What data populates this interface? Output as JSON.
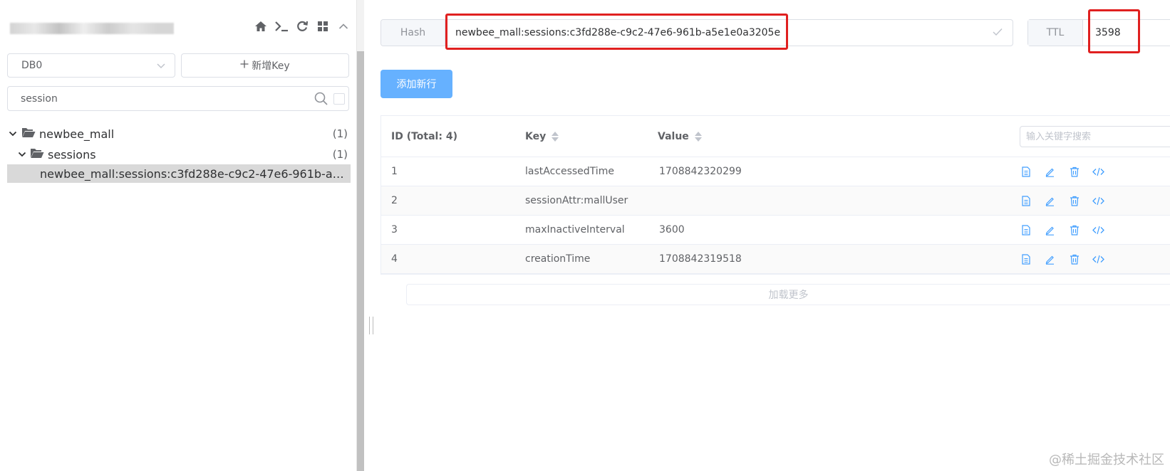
{
  "connection": {
    "name": "",
    "icons": [
      "home-icon",
      "terminal-icon",
      "refresh-icon",
      "grid-icon",
      "collapse-up-icon"
    ]
  },
  "db_select": {
    "value": "DB0"
  },
  "new_key_button": {
    "label": "新增Key"
  },
  "filter": {
    "value": "session"
  },
  "tree": {
    "folder1": {
      "label": "newbee_mall",
      "count": "(1)"
    },
    "folder2": {
      "label": "sessions",
      "count": "(1)"
    },
    "key_item": {
      "label": "newbee_mall:sessions:c3fd288e-c9c2-47e6-961b-a5e1..."
    }
  },
  "key_header": {
    "type_label": "Hash",
    "key_value": "newbee_mall:sessions:c3fd288e-c9c2-47e6-961b-a5e1e0a3205e",
    "ttl_label": "TTL",
    "ttl_value": "3598"
  },
  "add_row_button": {
    "label": "添加新行"
  },
  "table": {
    "headers": {
      "id": "ID (Total: 4)",
      "key": "Key",
      "value": "Value"
    },
    "search_placeholder": "输入关键字搜索",
    "rows": [
      {
        "id": "1",
        "key": "lastAccessedTime",
        "value": "1708842320299"
      },
      {
        "id": "2",
        "key": "sessionAttr:mallUser",
        "value": ""
      },
      {
        "id": "3",
        "key": "maxInactiveInterval",
        "value": "3600"
      },
      {
        "id": "4",
        "key": "creationTime",
        "value": "1708842319518"
      }
    ]
  },
  "load_more": {
    "label": "加载更多"
  },
  "watermark": {
    "text": "@稀土掘金技术社区"
  },
  "colors": {
    "primary": "#66b1ff",
    "icon_blue": "#409eff",
    "highlight": "#e02020"
  }
}
